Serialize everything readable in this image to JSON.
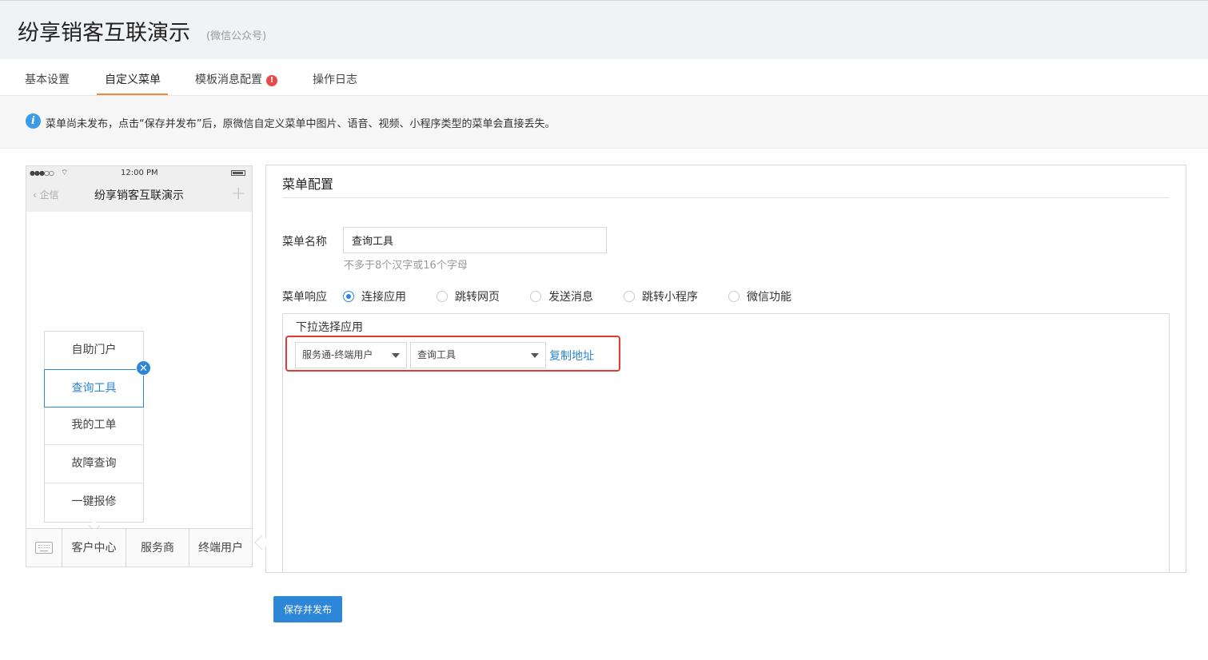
{
  "header": {
    "title": "纷享销客互联演示",
    "subtitle": "(微信公众号)"
  },
  "tabs": [
    {
      "label": "基本设置"
    },
    {
      "label": "自定义菜单",
      "active": true
    },
    {
      "label": "模板消息配置",
      "badge": "!"
    },
    {
      "label": "操作日志"
    }
  ],
  "notice": {
    "text": "菜单尚未发布，点击“保存并发布”后，原微信自定义菜单中图片、语音、视频、小程序类型的菜单会直接丢失。"
  },
  "phone": {
    "signal": "●●●○○",
    "wifi": "⌔",
    "time": "12:00 PM",
    "back_label": "企信",
    "title": "纷享销客互联演示",
    "plus": "+",
    "submenu": [
      "自助门户",
      "查询工具",
      "我的工单",
      "故障查询",
      "一键报修"
    ],
    "selected_submenu": "查询工具",
    "bottom_menu": [
      "客户中心",
      "服务商",
      "终端用户"
    ]
  },
  "config": {
    "title": "菜单配置",
    "name_label": "菜单名称",
    "name_value": "查询工具",
    "name_hint": "不多于8个汉字或16个字母",
    "response_label": "菜单响应",
    "response_options": [
      "连接应用",
      "跳转网页",
      "发送消息",
      "跳转小程序",
      "微信功能"
    ],
    "response_selected": "连接应用",
    "app_select_title": "下拉选择应用",
    "select_app": "服务通-终端用户",
    "select_tool": "查询工具",
    "copy_link": "复制地址"
  },
  "save_button": "保存并发布",
  "colors": {
    "accent": "#2e86d6",
    "tab_underline": "#f08c3c",
    "highlight": "#e53935",
    "badge": "#e74a4a"
  }
}
